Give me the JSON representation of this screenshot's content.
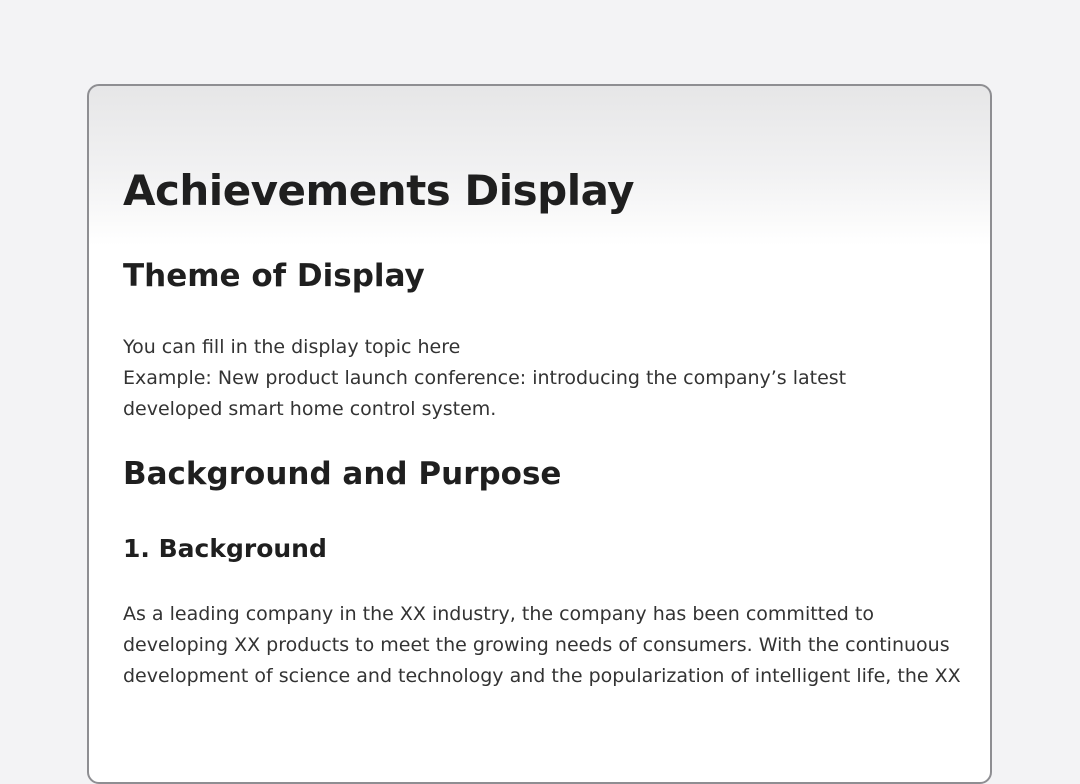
{
  "page_title": "Achievements Display",
  "sections": {
    "theme": {
      "heading": "Theme of Display",
      "lines": [
        "You can fill in the display topic here",
        "Example: New product launch conference: introducing the company’s latest",
        "developed smart home control system."
      ]
    },
    "background_purpose": {
      "heading": "Background and Purpose",
      "background": {
        "heading": "1. Background",
        "text": "As a leading company in the XX industry, the company has been committed to developing XX products to meet the growing needs of consumers. With the continuous development of science and technology and the popularization of intelligent life, the XX"
      }
    }
  }
}
